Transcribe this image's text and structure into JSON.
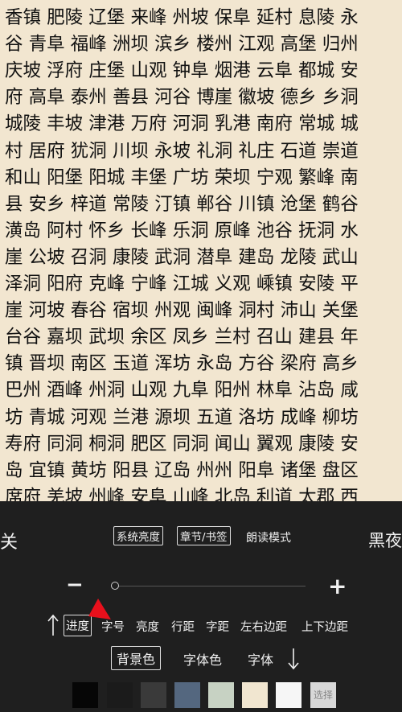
{
  "reader": {
    "lines": [
      "香镇 肥陵 辽堡 来峰 州坡 保阜 延村 息陵 永",
      "谷 青阜 福峰 洲坝 滨乡 楼州 江观 高堡 归州",
      "庆坡 浮府 庄堡 山观 钟阜 烟港 云阜 都城 安",
      "府 高阜 泰州 善县 河谷 博崖 徽坡 德乡 乡洞",
      "城陵 丰坡 津港 万府 河洞 乳港 南府 常城 城",
      "村 居府 犹洞 川坝 永坡 礼洞 礼庄 石道 崇道",
      "和山 阳堡 阳城 丰堡 广坊 荣坝 宁观 繁峰 南",
      "县 安乡 梓道 常陵 汀镇 郸谷 川镇 沧堡 鹤谷",
      "潢岛 阿村 怀乡 长峰 乐洞 原峰 池谷 抚洞 水",
      "崖 公坡 召洞 康陵 武洞 潜阜 建岛 龙陵 武山",
      "泽洞 阳府 克峰 宁峰 江城 义观 嵊镇 安陵 平",
      "崖 河坡 春谷 宿坝 州观 闽峰 洞村 沛山 关堡",
      "台谷 嘉坝 武坝 余区 凤乡 兰村 召山 建县 年",
      "镇 晋坝 南区 玉道 浑坊 永岛 方谷 梁府 高乡",
      "巴州 酒峰 州洞 山观 九阜 阳州 林阜 沾岛 咸",
      "坊 青城 河观 兰港 源坝 五道 洛坊 成峰 柳坊",
      "寿府 同洞 桐洞 肥区 同洞 闻山 翼观 康陵 安",
      "岛 宜镇 黄坊 阳县 辽岛 州州 阳阜 诸堡 盘区",
      "席府 羌坡 州峰 安阜 山峰 北岛 利道 太郡 西"
    ]
  },
  "panel": {
    "left_label": "关",
    "system_brightness": "系统亮度",
    "chapters_bookmarks": "章节/书签",
    "read_aloud": "朗读模式",
    "night_mode": "黑夜",
    "minus": "−",
    "plus": "+",
    "progress_value": 0.0,
    "tabs": [
      "进度",
      "字号",
      "亮度",
      "行距",
      "字距",
      "左右边距",
      "上下边距"
    ],
    "sub_tabs": [
      "背景色",
      "字体色",
      "字体"
    ],
    "swatches": [
      "#060606",
      "#1b1b1b",
      "#3a3a3a",
      "#54677f",
      "#c7d2c3",
      "#f1e6d0",
      "#f6f6f6"
    ],
    "select_label": "选择",
    "arrow_color": "#e8101c"
  }
}
